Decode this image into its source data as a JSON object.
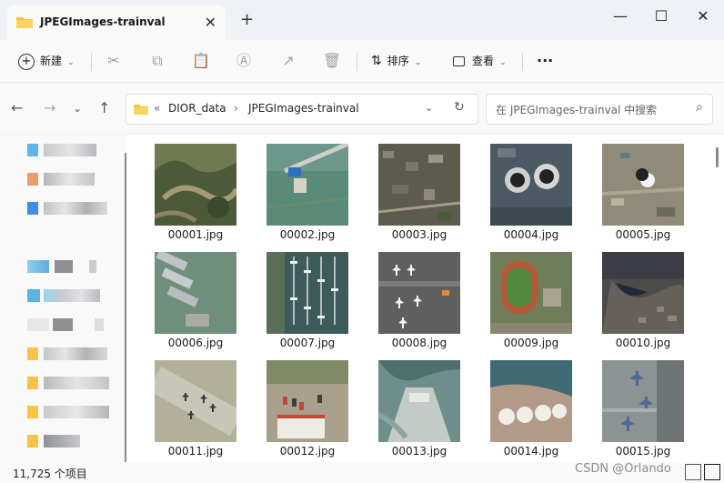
{
  "window": {
    "tab_title": "JPEGImages-trainval",
    "close_tab": "✕",
    "new_tab": "+",
    "minimize": "—",
    "maximize": "☐",
    "close": "✕"
  },
  "toolbar": {
    "new_label": "新建",
    "sort_label": "排序",
    "view_label": "查看",
    "more_label": "···"
  },
  "address": {
    "overflow": "«",
    "segments": [
      "DIOR_data",
      "JPEGImages-trainval"
    ],
    "separator": "›"
  },
  "search": {
    "placeholder": "在 JPEGImages-trainval 中搜索"
  },
  "files": [
    {
      "name": "00001.jpg"
    },
    {
      "name": "00002.jpg"
    },
    {
      "name": "00003.jpg"
    },
    {
      "name": "00004.jpg"
    },
    {
      "name": "00005.jpg"
    },
    {
      "name": "00006.jpg"
    },
    {
      "name": "00007.jpg"
    },
    {
      "name": "00008.jpg"
    },
    {
      "name": "00009.jpg"
    },
    {
      "name": "00010.jpg"
    },
    {
      "name": "00011.jpg"
    },
    {
      "name": "00012.jpg"
    },
    {
      "name": "00013.jpg"
    },
    {
      "name": "00014.jpg"
    },
    {
      "name": "00015.jpg"
    }
  ],
  "status": {
    "count": "11,725 个项目"
  },
  "watermark": "CSDN @Orlando",
  "colors": {
    "accent": "#f6c344",
    "window_bg": "#f9f9f9"
  }
}
